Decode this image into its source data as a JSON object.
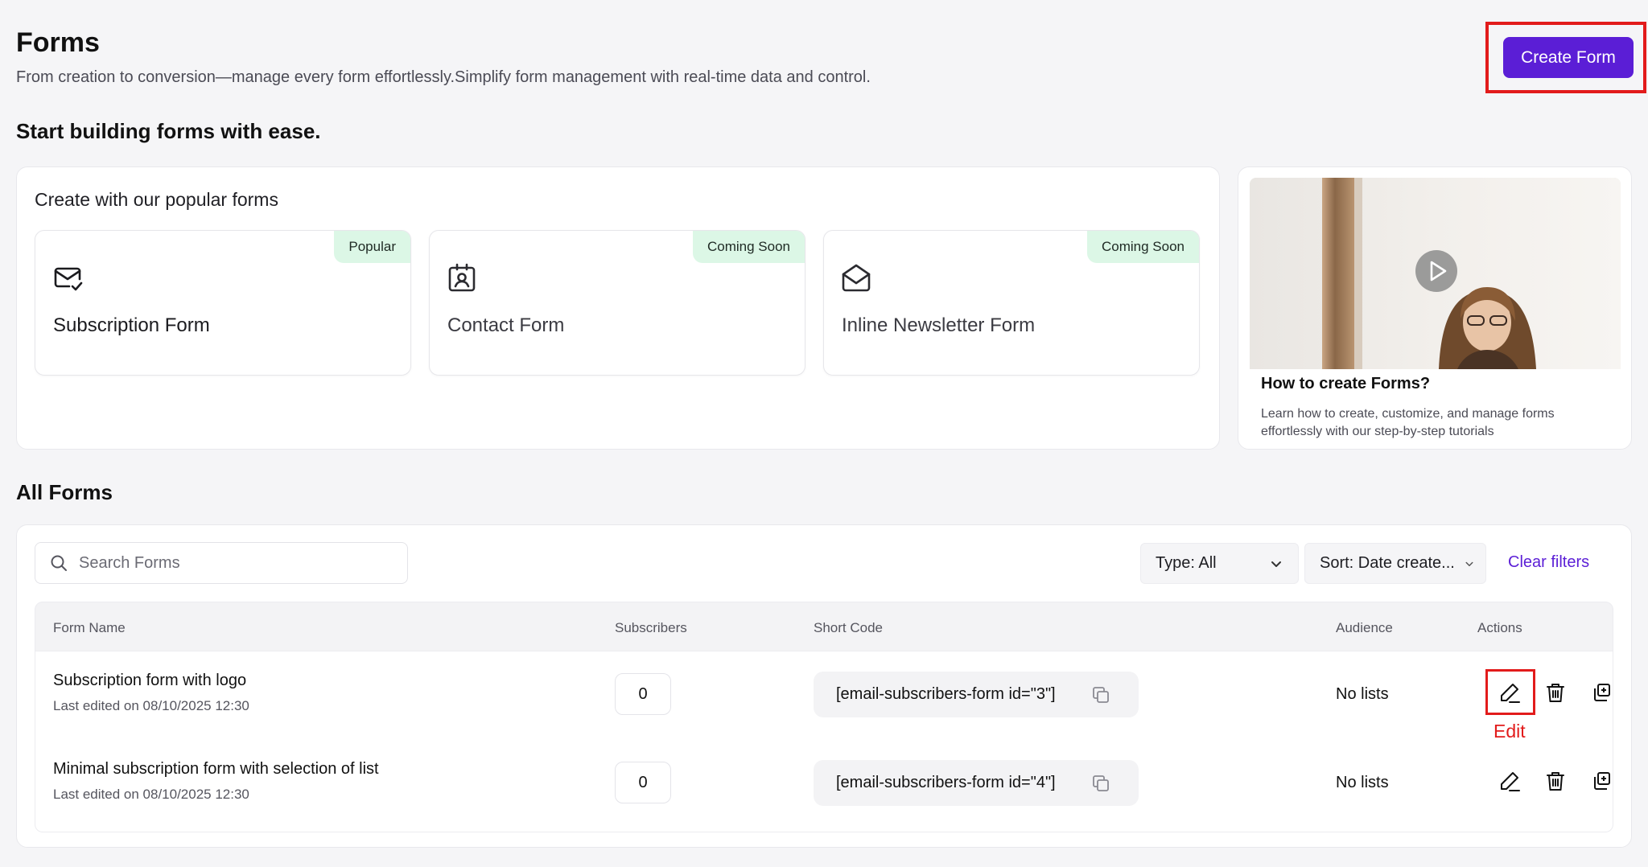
{
  "header": {
    "title": "Forms",
    "subtitle": "From creation to conversion—manage every form effortlessly.Simplify form management with real-time data and control.",
    "create_button": "Create Form"
  },
  "start": {
    "heading": "Start building forms with ease.",
    "popular_title": "Create with our popular forms",
    "tiles": [
      {
        "label": "Subscription Form",
        "badge": "Popular",
        "icon": "mail-check-icon"
      },
      {
        "label": "Contact Form",
        "badge": "Coming Soon",
        "icon": "contact-card-icon"
      },
      {
        "label": "Inline Newsletter Form",
        "badge": "Coming Soon",
        "icon": "open-envelope-icon"
      }
    ],
    "video": {
      "title": "How to create Forms?",
      "description_line1": "Learn how to create, customize, and manage forms",
      "description_line2": "effortlessly with our step-by-step tutorials",
      "icon": "play-icon"
    }
  },
  "all_forms": {
    "heading": "All Forms",
    "search_placeholder": "Search Forms",
    "type_filter": "Type: All",
    "sort_filter": "Sort: Date create...",
    "clear_filters": "Clear filters",
    "columns": [
      "Form Name",
      "Subscribers",
      "Short Code",
      "Audience",
      "Actions"
    ],
    "rows": [
      {
        "name": "Subscription form with logo",
        "edited": "Last edited on 08/10/2025 12:30",
        "subscribers": "0",
        "shortcode": "[email-subscribers-form id=\"3\"]",
        "audience": "No lists"
      },
      {
        "name": "Minimal subscription form with selection of list",
        "edited": "Last edited on 08/10/2025 12:30",
        "subscribers": "0",
        "shortcode": "[email-subscribers-form id=\"4\"]",
        "audience": "No lists"
      }
    ],
    "edit_annotation": "Edit"
  },
  "colors": {
    "accent": "#5b1ed6",
    "highlight": "#e21b1b",
    "badge_bg": "#dcf7e6"
  }
}
